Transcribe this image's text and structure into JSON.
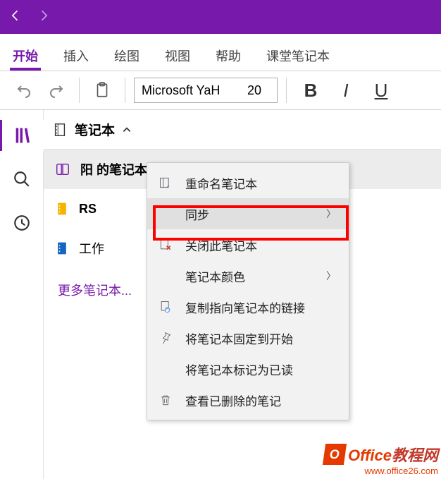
{
  "tabs": {
    "start": "开始",
    "insert": "插入",
    "draw": "绘图",
    "view": "视图",
    "help": "帮助",
    "class": "课堂笔记本"
  },
  "toolbar": {
    "font_name": "Microsoft YaH",
    "font_size": "20"
  },
  "panel": {
    "header": "笔记本",
    "more": "更多笔记本..."
  },
  "notebooks": {
    "n0": "阳 的笔记本",
    "n1": "RS",
    "n2": "工作"
  },
  "ctx": {
    "rename": "重命名笔记本",
    "sync": "同步",
    "close": "关闭此笔记本",
    "color": "笔记本颜色",
    "copylink": "复制指向笔记本的链接",
    "pin": "将笔记本固定到开始",
    "markread": "将笔记本标记为已读",
    "deleted": "查看已删除的笔记"
  },
  "watermark": {
    "brand1": "Office",
    "brand2": "教程网",
    "url": "www.office26.com"
  },
  "colors": {
    "brand": "#7719AA",
    "nb_yellow": "#F4B400",
    "nb_blue": "#1565C0"
  }
}
